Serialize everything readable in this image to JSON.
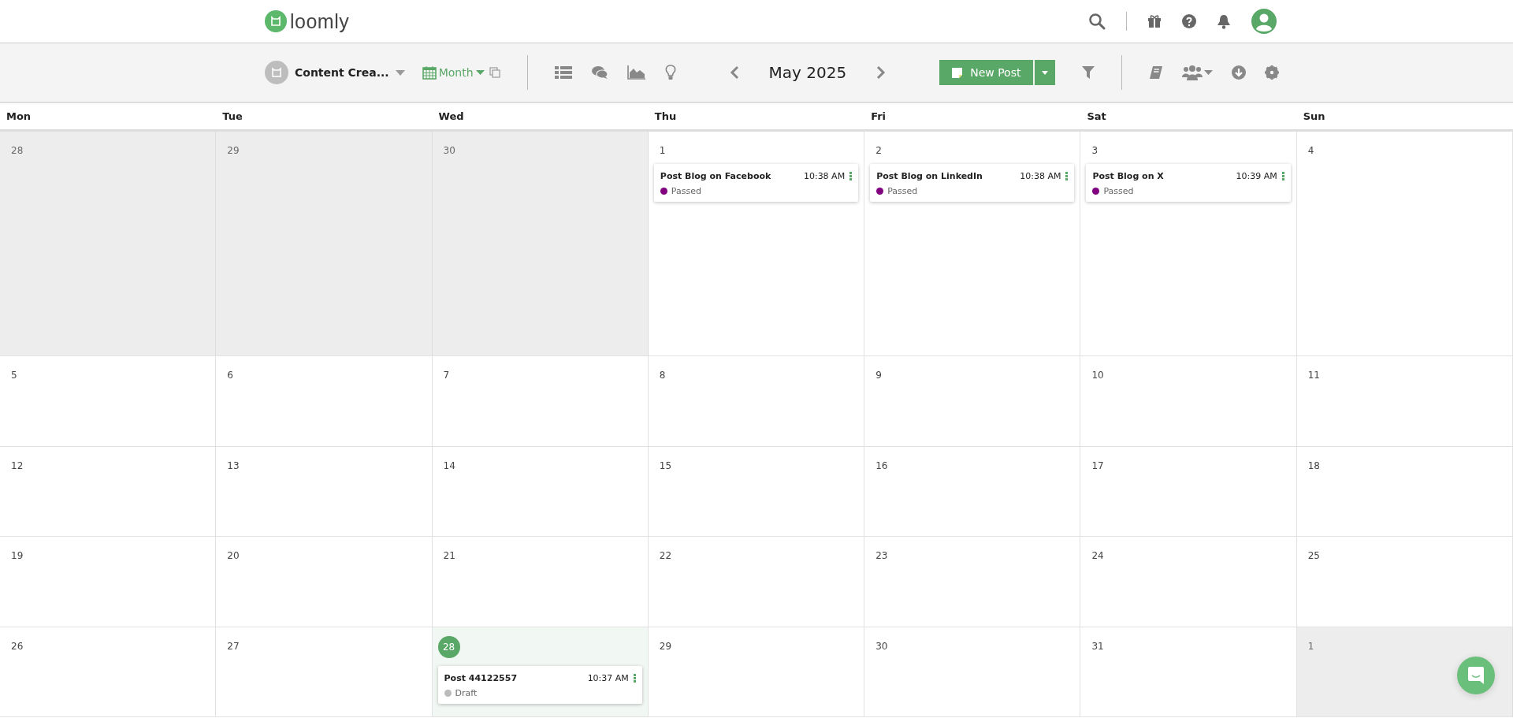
{
  "header": {
    "logo_text": "loomly"
  },
  "toolbar": {
    "calendar_name": "Content Crea...",
    "view": "Month",
    "month": "May 2025",
    "new_post": "New Post"
  },
  "weekdays": [
    "Mon",
    "Tue",
    "Wed",
    "Thu",
    "Fri",
    "Sat",
    "Sun"
  ],
  "weeks": [
    [
      {
        "date": "28",
        "outside": true,
        "today": false
      },
      {
        "date": "29",
        "outside": true,
        "today": false
      },
      {
        "date": "30",
        "outside": true,
        "today": false
      },
      {
        "date": "1",
        "outside": false,
        "today": false,
        "posts": [
          {
            "title": "Post Blog on Facebook",
            "time": "10:38 AM",
            "status": "Passed",
            "color": "#800080"
          }
        ]
      },
      {
        "date": "2",
        "outside": false,
        "today": false,
        "posts": [
          {
            "title": "Post Blog on LinkedIn",
            "time": "10:38 AM",
            "status": "Passed",
            "color": "#800080"
          }
        ]
      },
      {
        "date": "3",
        "outside": false,
        "today": false,
        "posts": [
          {
            "title": "Post Blog on X",
            "time": "10:39 AM",
            "status": "Passed",
            "color": "#800080"
          }
        ]
      },
      {
        "date": "4",
        "outside": false,
        "today": false
      }
    ],
    [
      {
        "date": "5",
        "outside": false,
        "today": false
      },
      {
        "date": "6",
        "outside": false,
        "today": false
      },
      {
        "date": "7",
        "outside": false,
        "today": false
      },
      {
        "date": "8",
        "outside": false,
        "today": false
      },
      {
        "date": "9",
        "outside": false,
        "today": false
      },
      {
        "date": "10",
        "outside": false,
        "today": false
      },
      {
        "date": "11",
        "outside": false,
        "today": false
      }
    ],
    [
      {
        "date": "12",
        "outside": false,
        "today": false
      },
      {
        "date": "13",
        "outside": false,
        "today": false
      },
      {
        "date": "14",
        "outside": false,
        "today": false
      },
      {
        "date": "15",
        "outside": false,
        "today": false
      },
      {
        "date": "16",
        "outside": false,
        "today": false
      },
      {
        "date": "17",
        "outside": false,
        "today": false
      },
      {
        "date": "18",
        "outside": false,
        "today": false
      }
    ],
    [
      {
        "date": "19",
        "outside": false,
        "today": false
      },
      {
        "date": "20",
        "outside": false,
        "today": false
      },
      {
        "date": "21",
        "outside": false,
        "today": false
      },
      {
        "date": "22",
        "outside": false,
        "today": false
      },
      {
        "date": "23",
        "outside": false,
        "today": false
      },
      {
        "date": "24",
        "outside": false,
        "today": false
      },
      {
        "date": "25",
        "outside": false,
        "today": false
      }
    ],
    [
      {
        "date": "26",
        "outside": false,
        "today": false
      },
      {
        "date": "27",
        "outside": false,
        "today": false
      },
      {
        "date": "28",
        "outside": false,
        "today": true,
        "posts": [
          {
            "title": "Post 44122557",
            "time": "10:37 AM",
            "status": "Draft",
            "color": "#bbbbbb"
          }
        ]
      },
      {
        "date": "29",
        "outside": false,
        "today": false
      },
      {
        "date": "30",
        "outside": false,
        "today": false
      },
      {
        "date": "31",
        "outside": false,
        "today": false
      },
      {
        "date": "1",
        "outside": true,
        "today": false
      }
    ]
  ]
}
